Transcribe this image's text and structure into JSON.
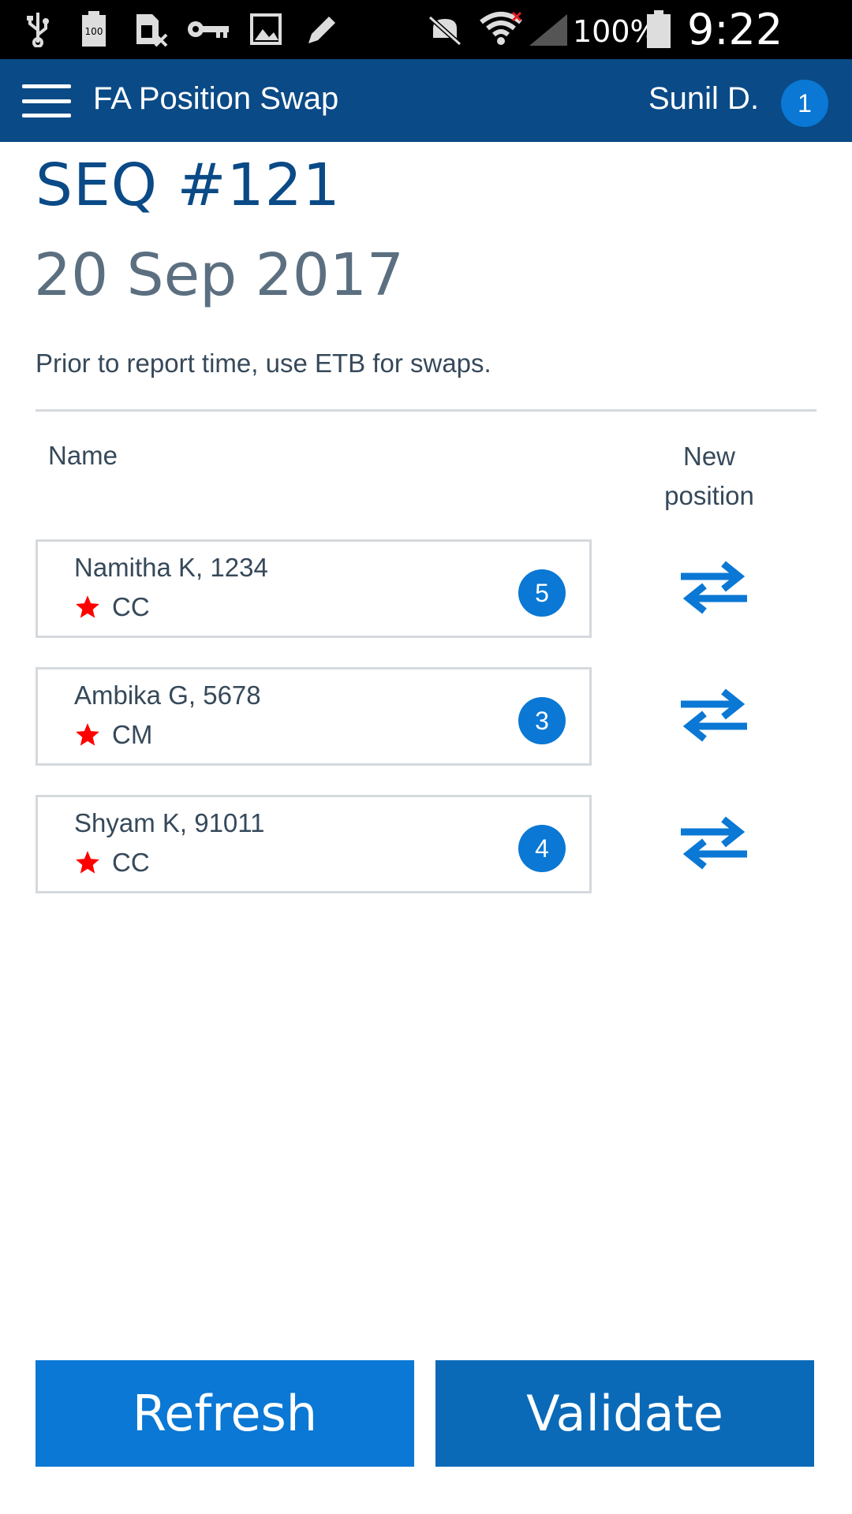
{
  "status_bar": {
    "battery_percent": "100%",
    "clock": "9:22 PM",
    "icons": [
      "usb-icon",
      "battery-100-icon",
      "sim-blocked-icon",
      "key-icon",
      "image-icon",
      "pencil-icon",
      "mute-icon",
      "wifi-icon",
      "signal-icon",
      "battery-icon"
    ]
  },
  "app_bar": {
    "menu_icon": "hamburger-menu-icon",
    "title": "FA Position Swap",
    "user_name": "Sunil D.",
    "notification_count": "1"
  },
  "header": {
    "sequence": "SEQ #121",
    "date": "20 Sep 2017",
    "note": "Prior to report time, use ETB for swaps."
  },
  "columns": {
    "name": "Name",
    "new_position": "New position"
  },
  "crew": [
    {
      "name": "Namitha K, 1234",
      "role": "CC",
      "position": "5"
    },
    {
      "name": "Ambika G, 5678",
      "role": "CM",
      "position": "3"
    },
    {
      "name": "Shyam K, 91011",
      "role": "CC",
      "position": "4"
    }
  ],
  "buttons": {
    "refresh": "Refresh",
    "validate": "Validate"
  },
  "colors": {
    "app_bar": "#0a4a86",
    "accent": "#0a78d4",
    "star": "#ff0000"
  }
}
